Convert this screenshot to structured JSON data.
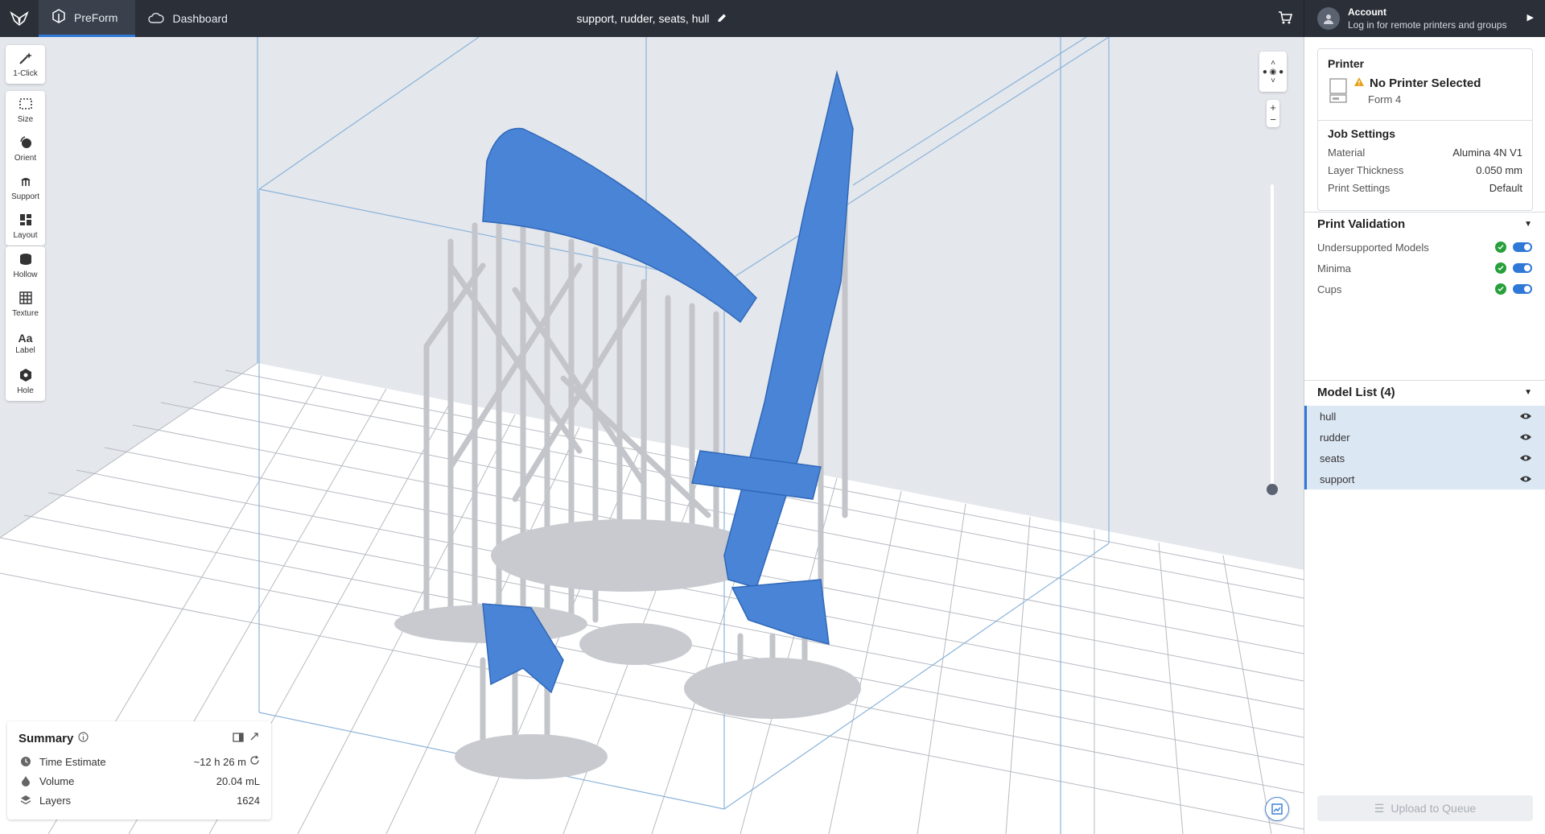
{
  "topbar": {
    "tabs": [
      {
        "label": "PreForm",
        "icon": "preform-icon",
        "active": true
      },
      {
        "label": "Dashboard",
        "icon": "cloud-icon",
        "active": false
      }
    ],
    "document_title": "support, rudder, seats, hull"
  },
  "account": {
    "title": "Account",
    "subtitle": "Log in for remote printers and groups"
  },
  "tools": {
    "group1": [
      {
        "label": "1-Click",
        "icon": "magic-wand-icon"
      }
    ],
    "group2": [
      {
        "label": "Size",
        "icon": "size-icon"
      },
      {
        "label": "Orient",
        "icon": "orient-icon"
      },
      {
        "label": "Support",
        "icon": "support-icon"
      },
      {
        "label": "Layout",
        "icon": "layout-icon"
      }
    ],
    "group3": [
      {
        "label": "Hollow",
        "icon": "hollow-icon"
      },
      {
        "label": "Texture",
        "icon": "texture-icon"
      },
      {
        "label": "Label",
        "icon": "label-icon"
      },
      {
        "label": "Hole",
        "icon": "hole-icon"
      }
    ]
  },
  "summary": {
    "title": "Summary",
    "rows": [
      {
        "label": "Time Estimate",
        "value": "~12 h 26 m",
        "icon": "clock-icon"
      },
      {
        "label": "Volume",
        "value": "20.04 mL",
        "icon": "volume-icon"
      },
      {
        "label": "Layers",
        "value": "1624",
        "icon": "layers-icon"
      }
    ]
  },
  "printer": {
    "header": "Printer",
    "name": "No Printer Selected",
    "model": "Form 4"
  },
  "job_settings": {
    "header": "Job Settings",
    "rows": [
      {
        "label": "Material",
        "value": "Alumina 4N V1"
      },
      {
        "label": "Layer Thickness",
        "value": "0.050 mm"
      },
      {
        "label": "Print Settings",
        "value": "Default"
      }
    ]
  },
  "validation": {
    "header": "Print Validation",
    "rows": [
      {
        "label": "Undersupported Models",
        "enabled": true
      },
      {
        "label": "Minima",
        "enabled": true
      },
      {
        "label": "Cups",
        "enabled": true
      }
    ]
  },
  "models": {
    "header": "Model List (4)",
    "items": [
      "hull",
      "rudder",
      "seats",
      "support"
    ]
  },
  "upload_label": "Upload to Queue",
  "colors": {
    "accent": "#2f78d8",
    "model_blue": "#4a84d6",
    "support_gray": "#bfc1c6",
    "topbar": "#2a2f38",
    "ok_green": "#27a03b"
  }
}
